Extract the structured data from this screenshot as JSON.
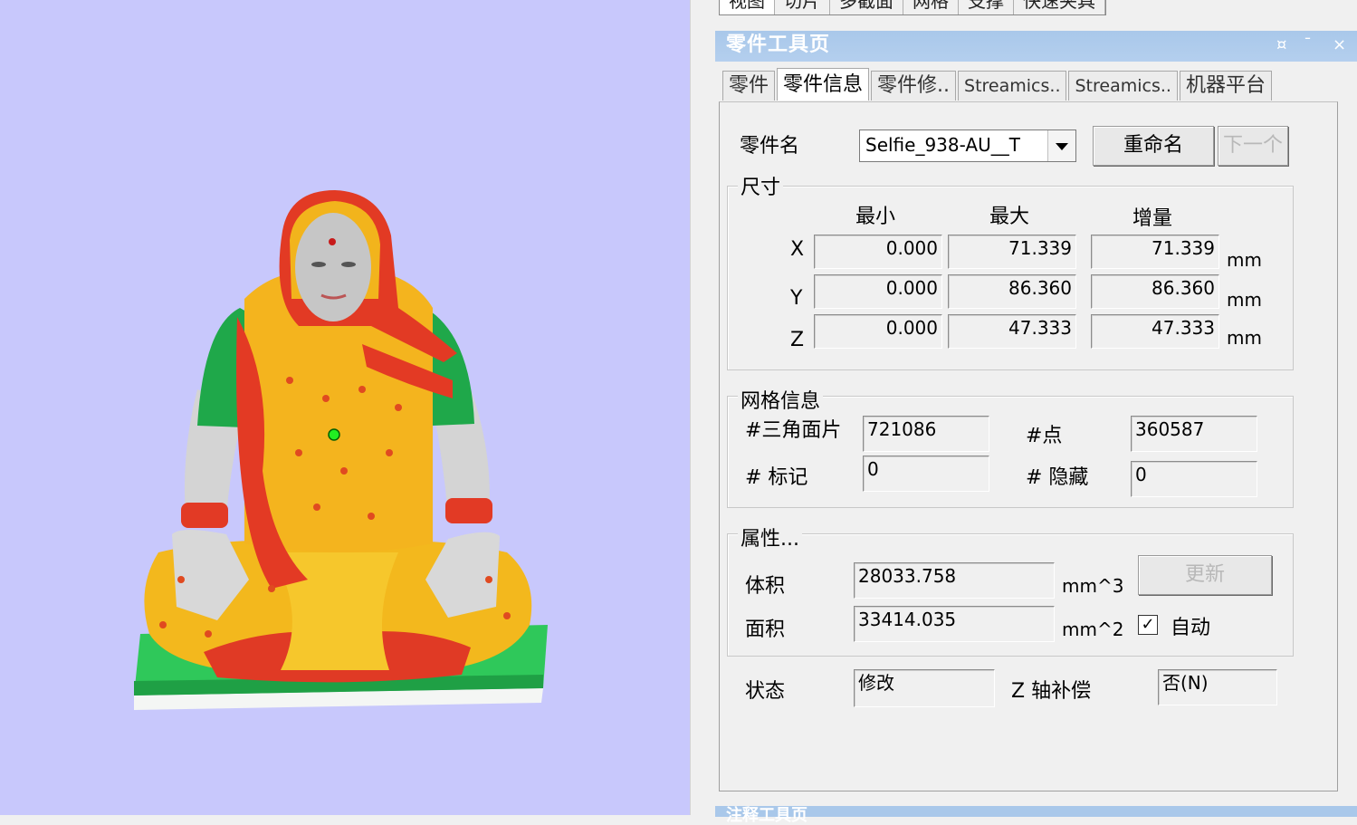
{
  "top_tabs": [
    "视图",
    "切片",
    "多截面",
    "网格",
    "支撑",
    "快速夹具"
  ],
  "panel": {
    "title": "零件工具页",
    "pin": "¤",
    "minimize": "ˉ",
    "close": "×"
  },
  "sub_tabs": [
    "零件",
    "零件信息",
    "零件修..",
    "Streamics..",
    "Streamics..",
    "机器平台"
  ],
  "part": {
    "name_label": "零件名",
    "name_value": "Selfie_938-AU__T",
    "rename": "重命名",
    "next": "下一个"
  },
  "dimensions": {
    "title": "尺寸",
    "headers": [
      "最小",
      "最大",
      "增量"
    ],
    "unit": "mm",
    "rows": [
      {
        "axis": "X",
        "min": "0.000",
        "max": "71.339",
        "delta": "71.339"
      },
      {
        "axis": "Y",
        "min": "0.000",
        "max": "86.360",
        "delta": "86.360"
      },
      {
        "axis": "Z",
        "min": "0.000",
        "max": "47.333",
        "delta": "47.333"
      }
    ]
  },
  "mesh": {
    "title": "网格信息",
    "triangles_label": "#三角面片",
    "triangles": "721086",
    "points_label": "#点",
    "points": "360587",
    "marked_label": "# 标记",
    "marked": "0",
    "hidden_label": "# 隐藏",
    "hidden": "0"
  },
  "props": {
    "title": "属性...",
    "volume_label": "体积",
    "volume": "28033.758",
    "volume_unit": "mm^3",
    "area_label": "面积",
    "area": "33414.035",
    "area_unit": "mm^2",
    "update": "更新",
    "auto_label": "自动",
    "auto_checked": true
  },
  "status": {
    "label": "状态",
    "value": "修改",
    "zcomp_label": "Z 轴补偿",
    "zcomp_value": "否(N)"
  },
  "bottom_panel_title": "注释工具页",
  "colors": {
    "viewport_bg": "#c8c8fc",
    "title_bar": "#a9c8ea"
  }
}
